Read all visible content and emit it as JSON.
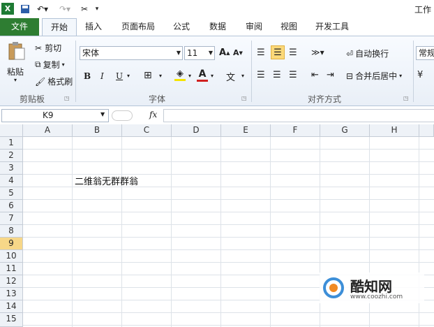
{
  "qat": {
    "title": "工作"
  },
  "tabs": [
    {
      "label": "文件"
    },
    {
      "label": "开始"
    },
    {
      "label": "插入"
    },
    {
      "label": "页面布局"
    },
    {
      "label": "公式"
    },
    {
      "label": "数据"
    },
    {
      "label": "审阅"
    },
    {
      "label": "视图"
    },
    {
      "label": "开发工具"
    }
  ],
  "clipboard": {
    "paste": "粘贴",
    "cut": "剪切",
    "copy": "复制",
    "format_painter": "格式刷",
    "label": "剪贴板"
  },
  "font": {
    "name": "宋体",
    "size": "11",
    "bold": "B",
    "italic": "I",
    "underline": "U",
    "label": "字体"
  },
  "alignment": {
    "wrap": "自动换行",
    "merge": "合并后居中",
    "label": "对齐方式"
  },
  "number": {
    "format": "常规"
  },
  "formula_bar": {
    "cell_ref": "K9",
    "fx": "fx"
  },
  "columns": [
    "A",
    "B",
    "C",
    "D",
    "E",
    "F",
    "G",
    "H"
  ],
  "rows": [
    "1",
    "2",
    "3",
    "4",
    "5",
    "6",
    "7",
    "8",
    "9",
    "10",
    "11",
    "12",
    "13",
    "14",
    "15"
  ],
  "selected_row": "9",
  "cells": {
    "B4": "二维翁无群群翁"
  },
  "watermark": {
    "brand": "酷知网",
    "url": "www.coozhi.com"
  },
  "colors": {
    "file_tab": "#2e7d32",
    "selected_row": "#f7d788",
    "font_red": "#d02020",
    "highlight_yellow": "#f5e400"
  }
}
